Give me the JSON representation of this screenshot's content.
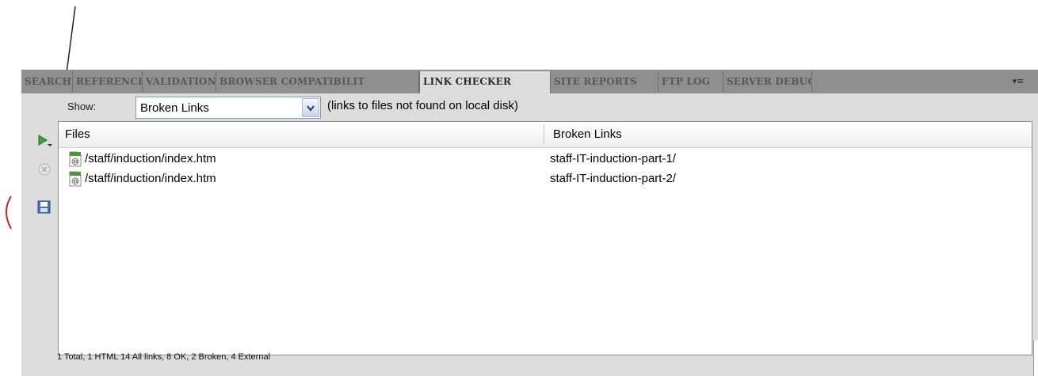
{
  "tabs": [
    {
      "label": "SEARCH",
      "active": false
    },
    {
      "label": "REFERENCE",
      "active": false
    },
    {
      "label": "VALIDATION",
      "active": false
    },
    {
      "label": "BROWSER COMPATIBILIT",
      "active": false
    },
    {
      "label": "LINK CHECKER",
      "active": true
    },
    {
      "label": "SITE REPORTS",
      "active": false
    },
    {
      "label": "FTP LOG",
      "active": false
    },
    {
      "label": "SERVER DEBUG",
      "active": false
    }
  ],
  "tab_menu_icon": "panel-options-menu-icon",
  "show": {
    "label": "Show:",
    "selected": "Broken Links",
    "description": "(links to files not found on local disk)"
  },
  "side_icons": [
    "run-check-icon",
    "stop-icon",
    "save-report-icon"
  ],
  "columns": {
    "files": "Files",
    "broken": "Broken Links"
  },
  "rows": [
    {
      "file": "/staff/induction/index.htm",
      "broken": "staff-IT-induction-part-1/"
    },
    {
      "file": "/staff/induction/index.htm",
      "broken": "staff-IT-induction-part-2/"
    }
  ],
  "status": "1 Total, 1 HTML  14 All links, 8 OK, 2 Broken, 4 External",
  "colors": {
    "panel_bg": "#dcdcdc",
    "tabbar_bg": "#8f8f8f",
    "tab_text_inactive": "#585858",
    "annotation_red": "#d42020"
  }
}
